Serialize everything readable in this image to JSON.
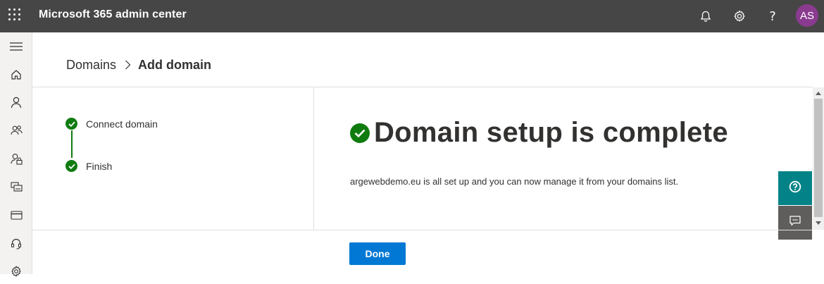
{
  "header": {
    "app_title": "Microsoft 365 admin center",
    "user_initials": "AS",
    "icons": [
      "waffle-icon",
      "bell-icon",
      "gear-icon",
      "help-icon"
    ]
  },
  "rail": {
    "icons": [
      "hamburger-menu-icon",
      "home-icon",
      "user-icon",
      "group-icon",
      "user-lock-icon",
      "devices-icon",
      "billing-icon",
      "support-headset-icon",
      "settings-icon"
    ]
  },
  "breadcrumb": {
    "parent": "Domains",
    "current": "Add domain"
  },
  "steps": [
    {
      "label": "Connect domain",
      "status": "complete"
    },
    {
      "label": "Finish",
      "status": "complete"
    }
  ],
  "main": {
    "title": "Domain setup is complete",
    "description": "argewebdemo.eu is all set up and you can now manage it from your domains list."
  },
  "footer": {
    "done_label": "Done"
  },
  "colors": {
    "topbar": "#464646",
    "success": "#107c10",
    "primary": "#0078d4",
    "help_teal": "#038387",
    "avatar": "#8a3b8f"
  }
}
